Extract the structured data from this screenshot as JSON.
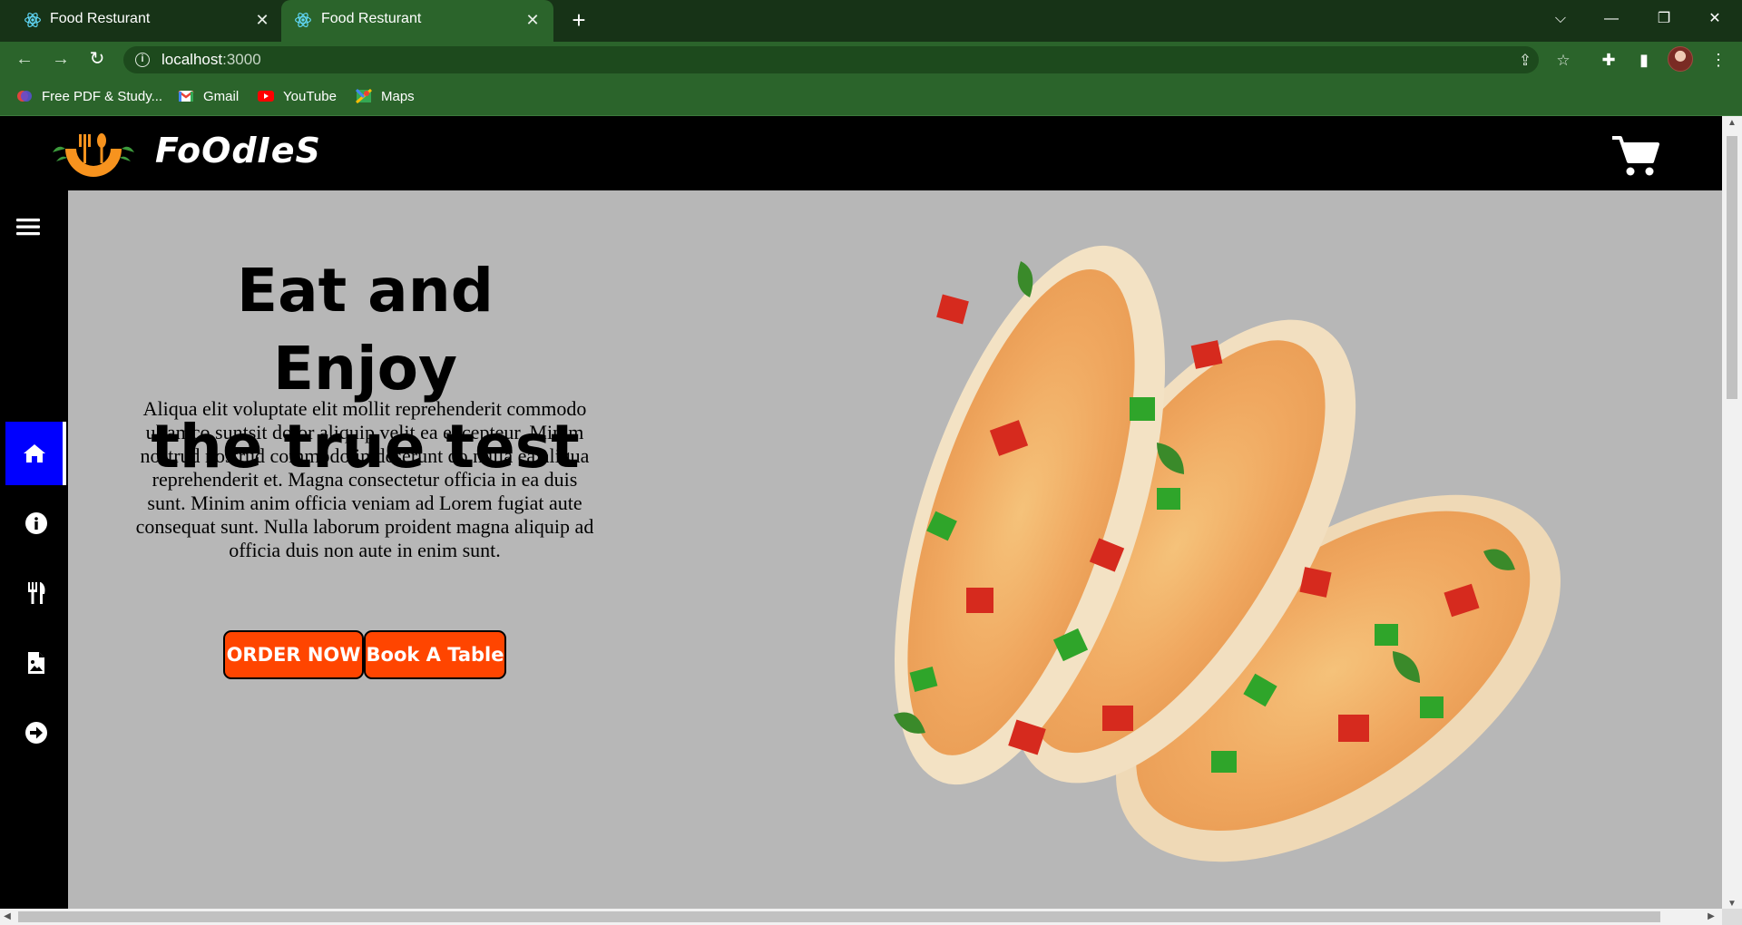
{
  "browser": {
    "tabs": [
      {
        "title": "Food Resturant",
        "active": false,
        "favicon": "react-icon"
      },
      {
        "title": "Food Resturant",
        "active": true,
        "favicon": "react-icon"
      }
    ],
    "new_tab": "+",
    "address": {
      "host": "localhost",
      "port": ":3000"
    },
    "bookmarks": [
      {
        "label": "Free PDF & Study...",
        "icon": "pdf-icon"
      },
      {
        "label": "Gmail",
        "icon": "gmail-icon"
      },
      {
        "label": "YouTube",
        "icon": "youtube-icon"
      },
      {
        "label": "Maps",
        "icon": "maps-icon"
      }
    ],
    "colors": {
      "frame": "#173317",
      "toolbar": "#2b642b"
    }
  },
  "site": {
    "brand": "FoOdIeS",
    "hero": {
      "title_line1": "Eat and Enjoy",
      "title_line2": "the true test",
      "text": "Aliqua elit voluptate elit mollit reprehenderit commodo ullamco suntsit dolor aliquip velit ea excepteur. Minim nostrud nostrud commodo in deserunt do nulla ea aliqua reprehenderit et. Magna consectetur officia in ea duis sunt. Minim anim officia veniam ad Lorem fugiat aute consequat sunt. Nulla laborum proident magna aliquip ad officia duis non aute in enim sunt.",
      "order_button": "ORDER NOW",
      "book_button": "Book A Table"
    },
    "sidebar": {
      "items": [
        {
          "icon": "home-icon",
          "active": true
        },
        {
          "icon": "info-icon",
          "active": false
        },
        {
          "icon": "utensils-icon",
          "active": false
        },
        {
          "icon": "file-image-icon",
          "active": false
        },
        {
          "icon": "arrow-right-circle-icon",
          "active": false
        }
      ]
    },
    "colors": {
      "accent": "#ff4500",
      "active_nav": "#0000ff",
      "background": "#b7b7b7",
      "nav": "#000000"
    }
  }
}
